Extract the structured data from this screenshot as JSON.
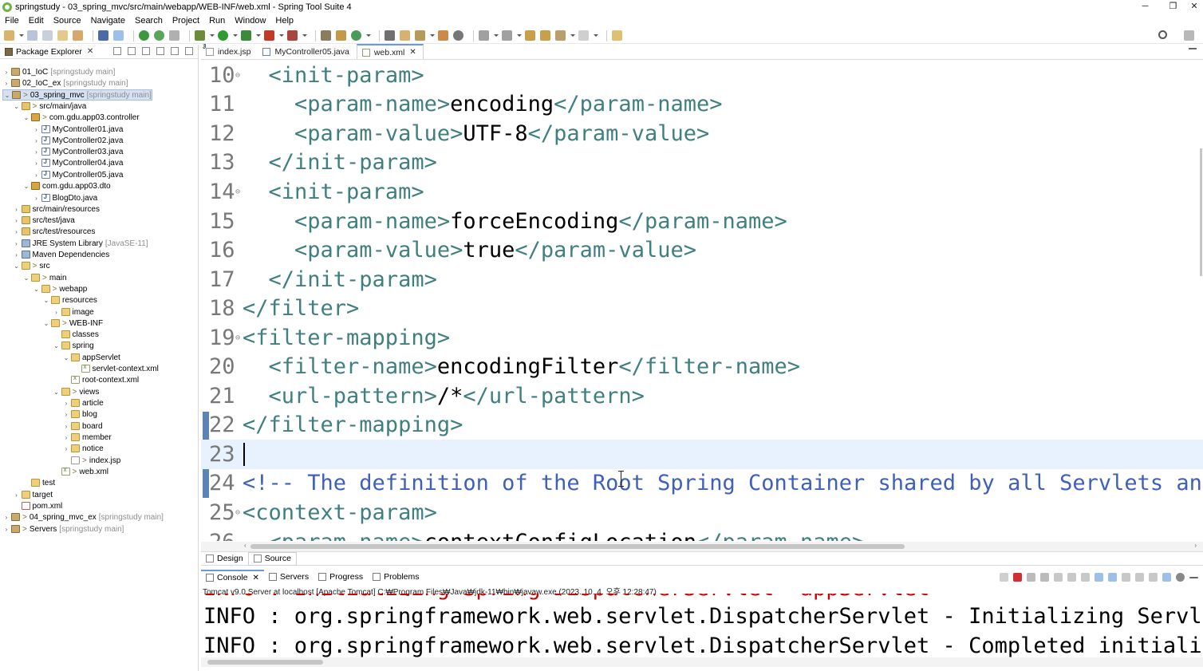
{
  "window": {
    "title": "springstudy - 03_spring_mvc/src/main/webapp/WEB-INF/web.xml - Spring Tool Suite 4",
    "minimize": "─",
    "restore": "❐",
    "close": "✕"
  },
  "menu": [
    "File",
    "Edit",
    "Source",
    "Navigate",
    "Search",
    "Project",
    "Run",
    "Window",
    "Help"
  ],
  "package_explorer": {
    "tab_label": "Package Explorer",
    "items": [
      {
        "label": "01_IoC",
        "ann": "[springstudy main]",
        "icon": "project-icon"
      },
      {
        "label": "02_IoC_ex",
        "ann": "[springstudy main]",
        "icon": "project-icon"
      },
      {
        "label": "03_spring_mvc",
        "ann": "[springstudy main]",
        "icon": "project-icon",
        "deco": ">"
      },
      {
        "label": "src/main/java",
        "icon": "source-folder-icon",
        "deco": ">"
      },
      {
        "label": "com.gdu.app03.controller",
        "icon": "package-icon",
        "deco": ">"
      },
      {
        "label": "MyController01.java",
        "icon": "java-file-icon"
      },
      {
        "label": "MyController02.java",
        "icon": "java-file-icon"
      },
      {
        "label": "MyController03.java",
        "icon": "java-file-icon"
      },
      {
        "label": "MyController04.java",
        "icon": "java-file-icon"
      },
      {
        "label": "MyController05.java",
        "icon": "java-file-icon"
      },
      {
        "label": "com.gdu.app03.dto",
        "icon": "package-icon"
      },
      {
        "label": "BlogDto.java",
        "icon": "java-file-icon"
      },
      {
        "label": "src/main/resources",
        "icon": "source-folder-icon"
      },
      {
        "label": "src/test/java",
        "icon": "source-folder-icon"
      },
      {
        "label": "src/test/resources",
        "icon": "source-folder-icon"
      },
      {
        "label": "JRE System Library",
        "ann": "[JavaSE-11]",
        "icon": "library-icon"
      },
      {
        "label": "Maven Dependencies",
        "icon": "library-icon"
      },
      {
        "label": "src",
        "icon": "folder-icon",
        "deco": ">"
      },
      {
        "label": "main",
        "icon": "folder-icon",
        "deco": ">"
      },
      {
        "label": "webapp",
        "icon": "folder-icon",
        "deco": ">"
      },
      {
        "label": "resources",
        "icon": "folder-icon"
      },
      {
        "label": "image",
        "icon": "folder-icon"
      },
      {
        "label": "WEB-INF",
        "icon": "folder-icon",
        "deco": ">"
      },
      {
        "label": "classes",
        "icon": "folder-icon"
      },
      {
        "label": "spring",
        "icon": "folder-icon"
      },
      {
        "label": "appServlet",
        "icon": "folder-icon"
      },
      {
        "label": "servlet-context.xml",
        "icon": "xml-file-icon"
      },
      {
        "label": "root-context.xml",
        "icon": "xml-file-icon"
      },
      {
        "label": "views",
        "icon": "folder-icon",
        "deco": ">"
      },
      {
        "label": "article",
        "icon": "folder-icon"
      },
      {
        "label": "blog",
        "icon": "folder-icon"
      },
      {
        "label": "board",
        "icon": "folder-icon"
      },
      {
        "label": "member",
        "icon": "folder-icon"
      },
      {
        "label": "notice",
        "icon": "folder-icon"
      },
      {
        "label": "index.jsp",
        "icon": "jsp-file-icon",
        "deco": ">"
      },
      {
        "label": "web.xml",
        "icon": "xml-file-icon",
        "deco": ">"
      },
      {
        "label": "test",
        "icon": "folder-icon"
      },
      {
        "label": "target",
        "icon": "folder-icon"
      },
      {
        "label": "pom.xml",
        "icon": "pom-file-icon"
      },
      {
        "label": "04_spring_mvc_ex",
        "ann": "[springstudy main]",
        "icon": "project-icon",
        "deco": ">"
      },
      {
        "label": "Servers",
        "ann": "[springstudy main]",
        "icon": "project-icon",
        "deco": ">"
      }
    ]
  },
  "editor": {
    "tabs": [
      {
        "label": "index.jsp",
        "icon": "jsp-file-icon"
      },
      {
        "label": "MyController05.java",
        "icon": "java-file-icon"
      },
      {
        "label": "web.xml",
        "icon": "xml-file-icon",
        "close": "✕"
      }
    ],
    "lines": [
      {
        "n": "10",
        "fold": "⊖",
        "indent": "  ",
        "html_parts": [
          [
            "tag",
            "<init-param>"
          ]
        ]
      },
      {
        "n": "11",
        "indent": "    ",
        "html_parts": [
          [
            "tag",
            "<param-name>"
          ],
          [
            "txt",
            "encoding"
          ],
          [
            "tag",
            "</param-name>"
          ]
        ]
      },
      {
        "n": "12",
        "indent": "    ",
        "html_parts": [
          [
            "tag",
            "<param-value>"
          ],
          [
            "txt",
            "UTF-8"
          ],
          [
            "tag",
            "</param-value>"
          ]
        ]
      },
      {
        "n": "13",
        "indent": "  ",
        "html_parts": [
          [
            "tag",
            "</init-param>"
          ]
        ]
      },
      {
        "n": "14",
        "fold": "⊖",
        "indent": "  ",
        "html_parts": [
          [
            "tag",
            "<init-param>"
          ]
        ]
      },
      {
        "n": "15",
        "indent": "    ",
        "html_parts": [
          [
            "tag",
            "<param-name>"
          ],
          [
            "txt",
            "forceEncoding"
          ],
          [
            "tag",
            "</param-name>"
          ]
        ]
      },
      {
        "n": "16",
        "indent": "    ",
        "html_parts": [
          [
            "tag",
            "<param-value>"
          ],
          [
            "txt",
            "true"
          ],
          [
            "tag",
            "</param-value>"
          ]
        ]
      },
      {
        "n": "17",
        "indent": "  ",
        "html_parts": [
          [
            "tag",
            "</init-param>"
          ]
        ]
      },
      {
        "n": "18",
        "indent": "",
        "html_parts": [
          [
            "tag",
            "</filter>"
          ]
        ]
      },
      {
        "n": "19",
        "fold": "⊖",
        "indent": "",
        "html_parts": [
          [
            "tag",
            "<filter-mapping>"
          ]
        ]
      },
      {
        "n": "20",
        "indent": "  ",
        "html_parts": [
          [
            "tag",
            "<filter-name>"
          ],
          [
            "txt",
            "encodingFilter"
          ],
          [
            "tag",
            "</filter-name>"
          ]
        ]
      },
      {
        "n": "21",
        "indent": "  ",
        "html_parts": [
          [
            "tag",
            "<url-pattern>"
          ],
          [
            "txt",
            "/*"
          ],
          [
            "tag",
            "</url-pattern>"
          ]
        ]
      },
      {
        "n": "22",
        "indent": "",
        "html_parts": [
          [
            "tag",
            "</filter-mapping>"
          ]
        ]
      },
      {
        "n": "23",
        "indent": "",
        "html_parts": [],
        "current": true
      },
      {
        "n": "24",
        "indent": "",
        "html_parts": [
          [
            "cmt",
            "<!-- The definition of the Root Spring Container shared by all Servlets an"
          ]
        ]
      },
      {
        "n": "25",
        "fold": "⊖",
        "indent": "",
        "html_parts": [
          [
            "tag",
            "<context-param>"
          ]
        ]
      },
      {
        "n": "26",
        "indent": "  ",
        "html_parts": [
          [
            "tag",
            "<param-name>"
          ],
          [
            "txt",
            "contextConfigLocation"
          ],
          [
            "tag",
            "</param-name>"
          ]
        ]
      }
    ],
    "bottom_tabs": [
      "Design",
      "Source"
    ]
  },
  "console": {
    "tabs": [
      {
        "label": "Console",
        "close": "✕"
      },
      {
        "label": "Servers"
      },
      {
        "label": "Progress"
      },
      {
        "label": "Problems"
      }
    ],
    "launch": "Tomcat v9.0 Server at localhost [Apache Tomcat] C:₩Program Files₩Java₩jdk-11₩bin₩javaw.exe  (2023. 10. 4. 오후 12:28:47)",
    "lines": [
      {
        "text": "INFO : Initializing Spring DispatcherServlet 'appServlet'",
        "red": true
      },
      {
        "text": "INFO : org.springframework.web.servlet.DispatcherServlet - Initializing Servlet"
      },
      {
        "text": "INFO : org.springframework.web.servlet.DispatcherServlet - Completed initializa"
      }
    ]
  },
  "colors": {
    "tag": "#3f7f7f",
    "comment": "#3f5fbf",
    "current_line": "#e8f2fe",
    "change_bar": "#5c84b5",
    "console_error": "#d00000"
  }
}
